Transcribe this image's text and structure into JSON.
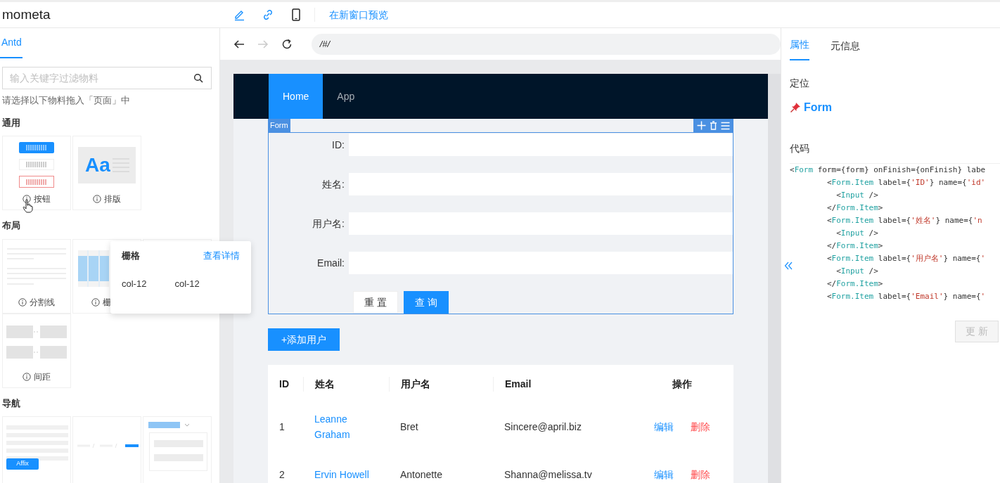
{
  "header": {
    "logo": "mometa",
    "tools": [
      {
        "kind": "pencil",
        "selected": true
      },
      {
        "kind": "link",
        "selected": true
      },
      {
        "kind": "phone",
        "selected": false
      }
    ],
    "preview_link": "在新窗口预览"
  },
  "left_panel": {
    "tabs": [
      {
        "label": "Antd",
        "selected": true
      }
    ],
    "search": {
      "placeholder": "输入关键字过滤物料"
    },
    "hint": "请选择以下物料拖入「页面」中",
    "groups": [
      {
        "title": "通用",
        "items": [
          {
            "kind": "button",
            "label": "按钮"
          },
          {
            "kind": "typography",
            "label": "排版",
            "preview_text": "Aa"
          }
        ]
      },
      {
        "title": "布局",
        "items": [
          {
            "kind": "divider",
            "label": "分割线"
          },
          {
            "kind": "grid",
            "label": "栅"
          },
          {
            "kind": "blank"
          },
          {
            "kind": "space",
            "label": "间距"
          }
        ]
      },
      {
        "title": "导航",
        "items": [
          {
            "kind": "affix",
            "preview_text": "Affix"
          },
          {
            "kind": "breadcrumb"
          },
          {
            "kind": "dropdown"
          }
        ]
      }
    ]
  },
  "tooltip": {
    "title": "栅格",
    "link": "查看详情",
    "cols": [
      "col-12",
      "col-12"
    ]
  },
  "preview": {
    "url": "/#/",
    "forward_disabled": true,
    "nav": [
      {
        "label": "Home",
        "selected": true
      },
      {
        "label": "App",
        "selected": false
      }
    ],
    "form": {
      "tag": "Form",
      "fields": [
        {
          "label": "ID:"
        },
        {
          "label": "姓名:"
        },
        {
          "label": "用户名:"
        },
        {
          "label": "Email:"
        }
      ],
      "buttons": [
        {
          "label": "重 置",
          "kind": "default"
        },
        {
          "label": "查 询",
          "kind": "primary"
        }
      ]
    },
    "add_button": "+添加用户",
    "table": {
      "columns": [
        "ID",
        "姓名",
        "用户名",
        "Email",
        "操作"
      ],
      "rows": [
        {
          "id": "1",
          "name": "Leanne Graham",
          "username": "Bret",
          "email": "Sincere@april.biz",
          "actions": [
            "编辑",
            "删除"
          ]
        },
        {
          "id": "2",
          "name": "Ervin Howell",
          "username": "Antonette",
          "email": "Shanna@melissa.tv",
          "actions": [
            "编辑",
            "删除"
          ]
        }
      ]
    }
  },
  "right_panel": {
    "tabs": [
      {
        "label": "属性",
        "selected": true
      },
      {
        "label": "元信息",
        "selected": false
      }
    ],
    "locate_title": "定位",
    "located": "Form",
    "code_title": "代码",
    "code": [
      "<Form form={form} onFinish={onFinish} labe",
      "        <Form.Item label={'ID'} name={'id'",
      "          <Input />",
      "        </Form.Item>",
      "        <Form.Item label={'姓名'} name={'n",
      "          <Input />",
      "        </Form.Item>",
      "        <Form.Item label={'用户名'} name={'",
      "          <Input />",
      "        </Form.Item>",
      "        <Form.Item label={'Email'} name={'"
    ],
    "update_button": {
      "label": "更 新",
      "disabled": true
    }
  }
}
